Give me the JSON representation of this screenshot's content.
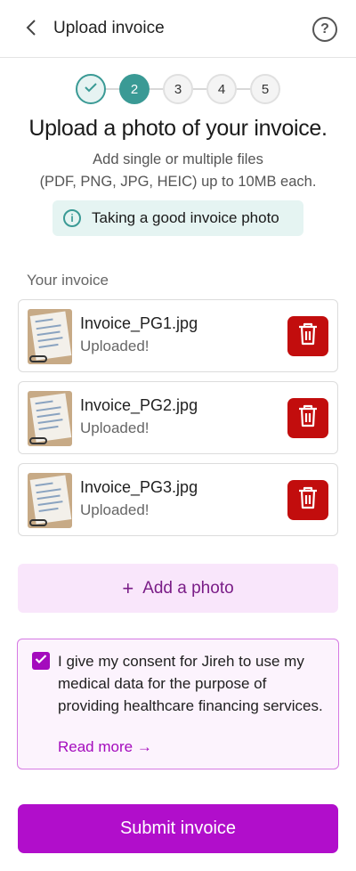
{
  "header": {
    "title": "Upload invoice",
    "back_icon": "chevron-left-icon",
    "help_icon": "help-circle-icon",
    "help_glyph": "?"
  },
  "stepper": {
    "current_step": 2,
    "steps": [
      {
        "label": "",
        "state": "done",
        "icon": "check-icon"
      },
      {
        "label": "2",
        "state": "active"
      },
      {
        "label": "3",
        "state": "todo"
      },
      {
        "label": "4",
        "state": "todo"
      },
      {
        "label": "5",
        "state": "todo"
      }
    ]
  },
  "main": {
    "title": "Upload a photo of your invoice.",
    "subtitle_line1": "Add single or multiple files",
    "subtitle_line2": "(PDF, PNG, JPG, HEIC) up to 10MB each.",
    "tip_label": "Taking a good invoice photo",
    "tip_icon": "info-icon",
    "tip_glyph": "i"
  },
  "files": {
    "section_label": "Your invoice",
    "items": [
      {
        "name": "Invoice_PG1.jpg",
        "status": "Uploaded!"
      },
      {
        "name": "Invoice_PG2.jpg",
        "status": "Uploaded!"
      },
      {
        "name": "Invoice_PG3.jpg",
        "status": "Uploaded!"
      }
    ],
    "delete_icon": "trash-icon"
  },
  "add_photo": {
    "plus": "+",
    "label": "Add a photo"
  },
  "consent": {
    "checked": true,
    "text": "I give my consent for Jireh to use my medical data for the purpose of providing healthcare financing services.",
    "read_more": "Read more →"
  },
  "submit": {
    "label": "Submit invoice"
  },
  "colors": {
    "teal": "#3a9a95",
    "tip_bg": "#e5f4f2",
    "delete_red": "#c20d0d",
    "purple": "#b10ecb",
    "purple_dark": "#7a1d87",
    "add_bg": "#f9e6fb",
    "consent_bg": "#fcf3fd",
    "consent_border": "#d57ae3"
  }
}
